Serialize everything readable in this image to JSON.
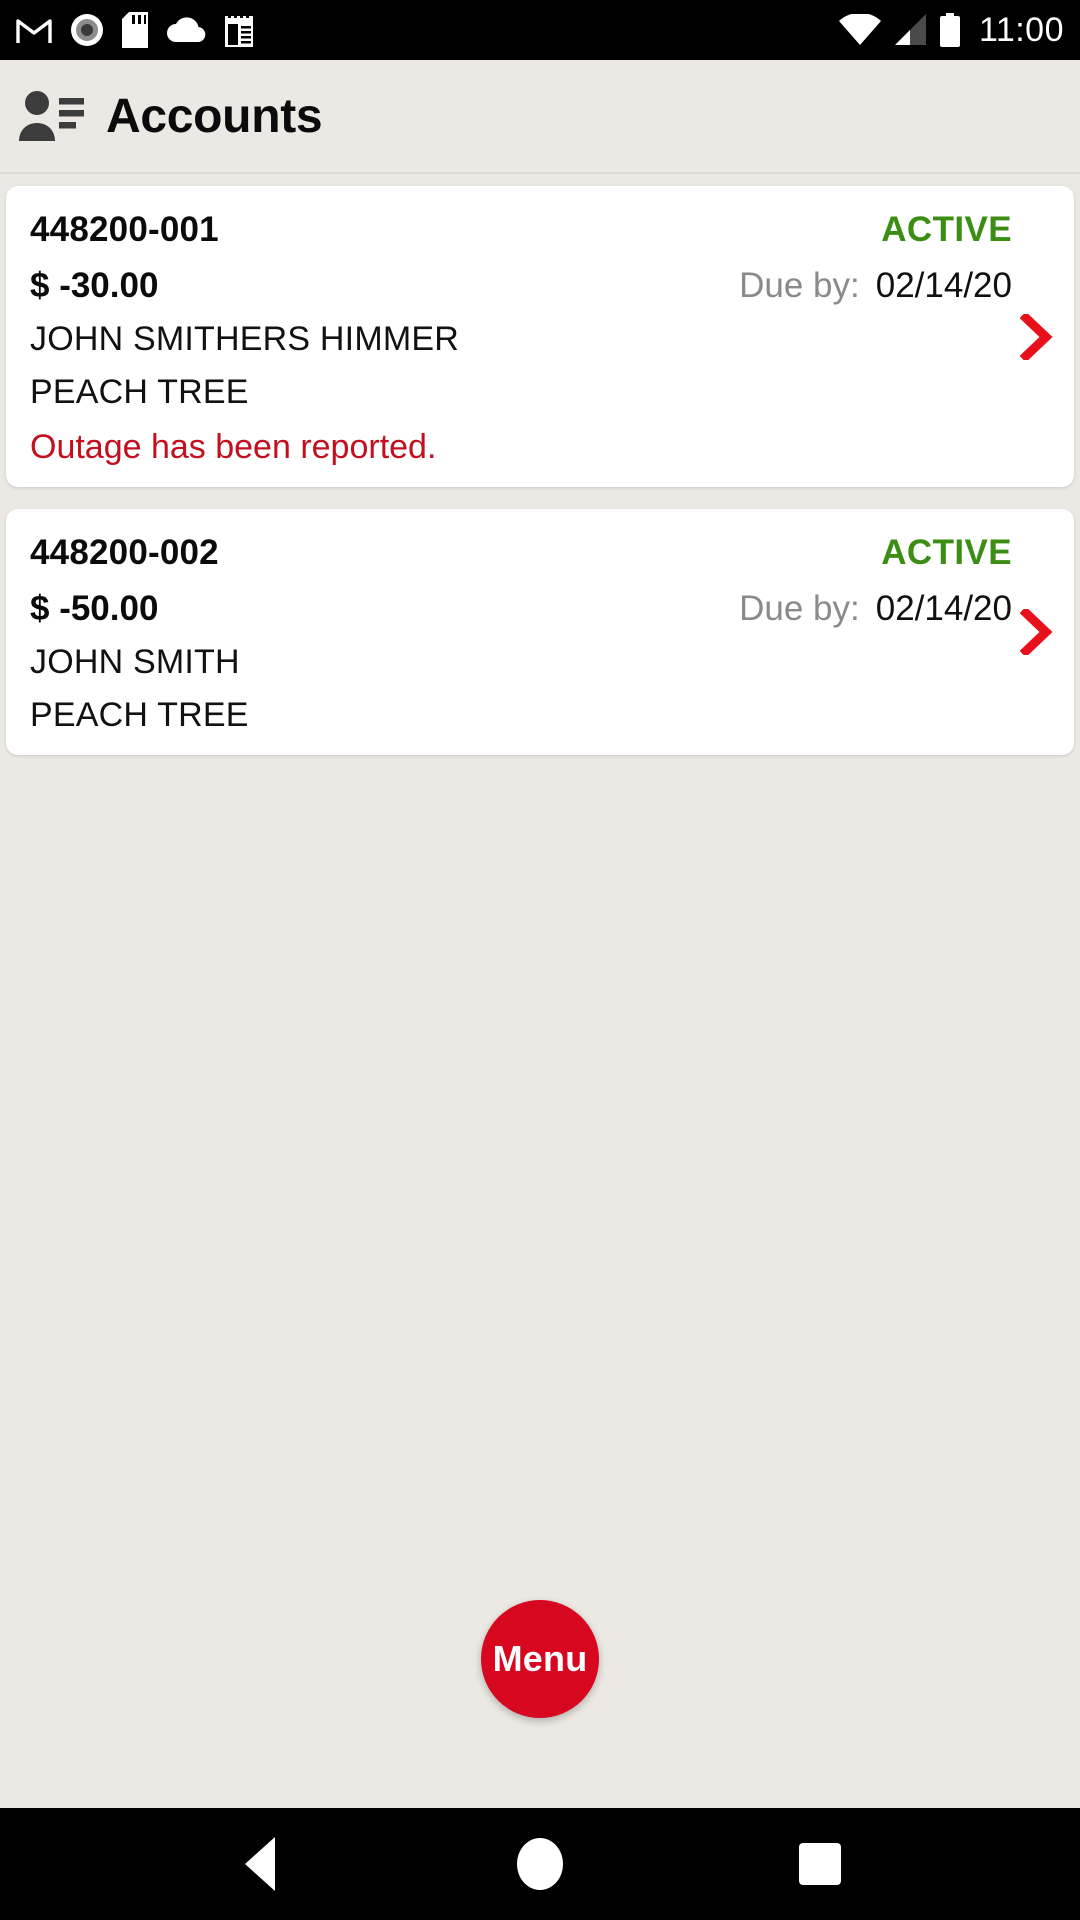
{
  "status_bar": {
    "time": "11:00",
    "left_icons": [
      "gmail-icon",
      "record-icon",
      "sd-card-icon",
      "cloud-icon",
      "notes-icon"
    ],
    "right_icons": [
      "wifi-icon",
      "cellular-signal-icon",
      "battery-icon"
    ]
  },
  "header": {
    "title": "Accounts",
    "icon": "accounts-contact-icon"
  },
  "colors": {
    "background": "#ece9e4",
    "card": "#ffffff",
    "status_active": "#3c8d14",
    "warning": "#c2101f",
    "chevron": "#e8101a",
    "fab": "#d6071f"
  },
  "accounts": [
    {
      "account_number": "448200-001",
      "status": "ACTIVE",
      "amount": "$ -30.00",
      "due_label": "Due by:",
      "due_date": "02/14/20",
      "customer_name": "JOHN SMITHERS HIMMER",
      "location": "PEACH TREE",
      "notice": "Outage has been reported."
    },
    {
      "account_number": "448200-002",
      "status": "ACTIVE",
      "amount": "$ -50.00",
      "due_label": "Due by:",
      "due_date": "02/14/20",
      "customer_name": "JOHN SMITH",
      "location": "PEACH TREE",
      "notice": ""
    }
  ],
  "fab": {
    "label": "Menu"
  },
  "nav_bar": {
    "back": "back-button",
    "home": "home-button",
    "recents": "recents-button"
  }
}
